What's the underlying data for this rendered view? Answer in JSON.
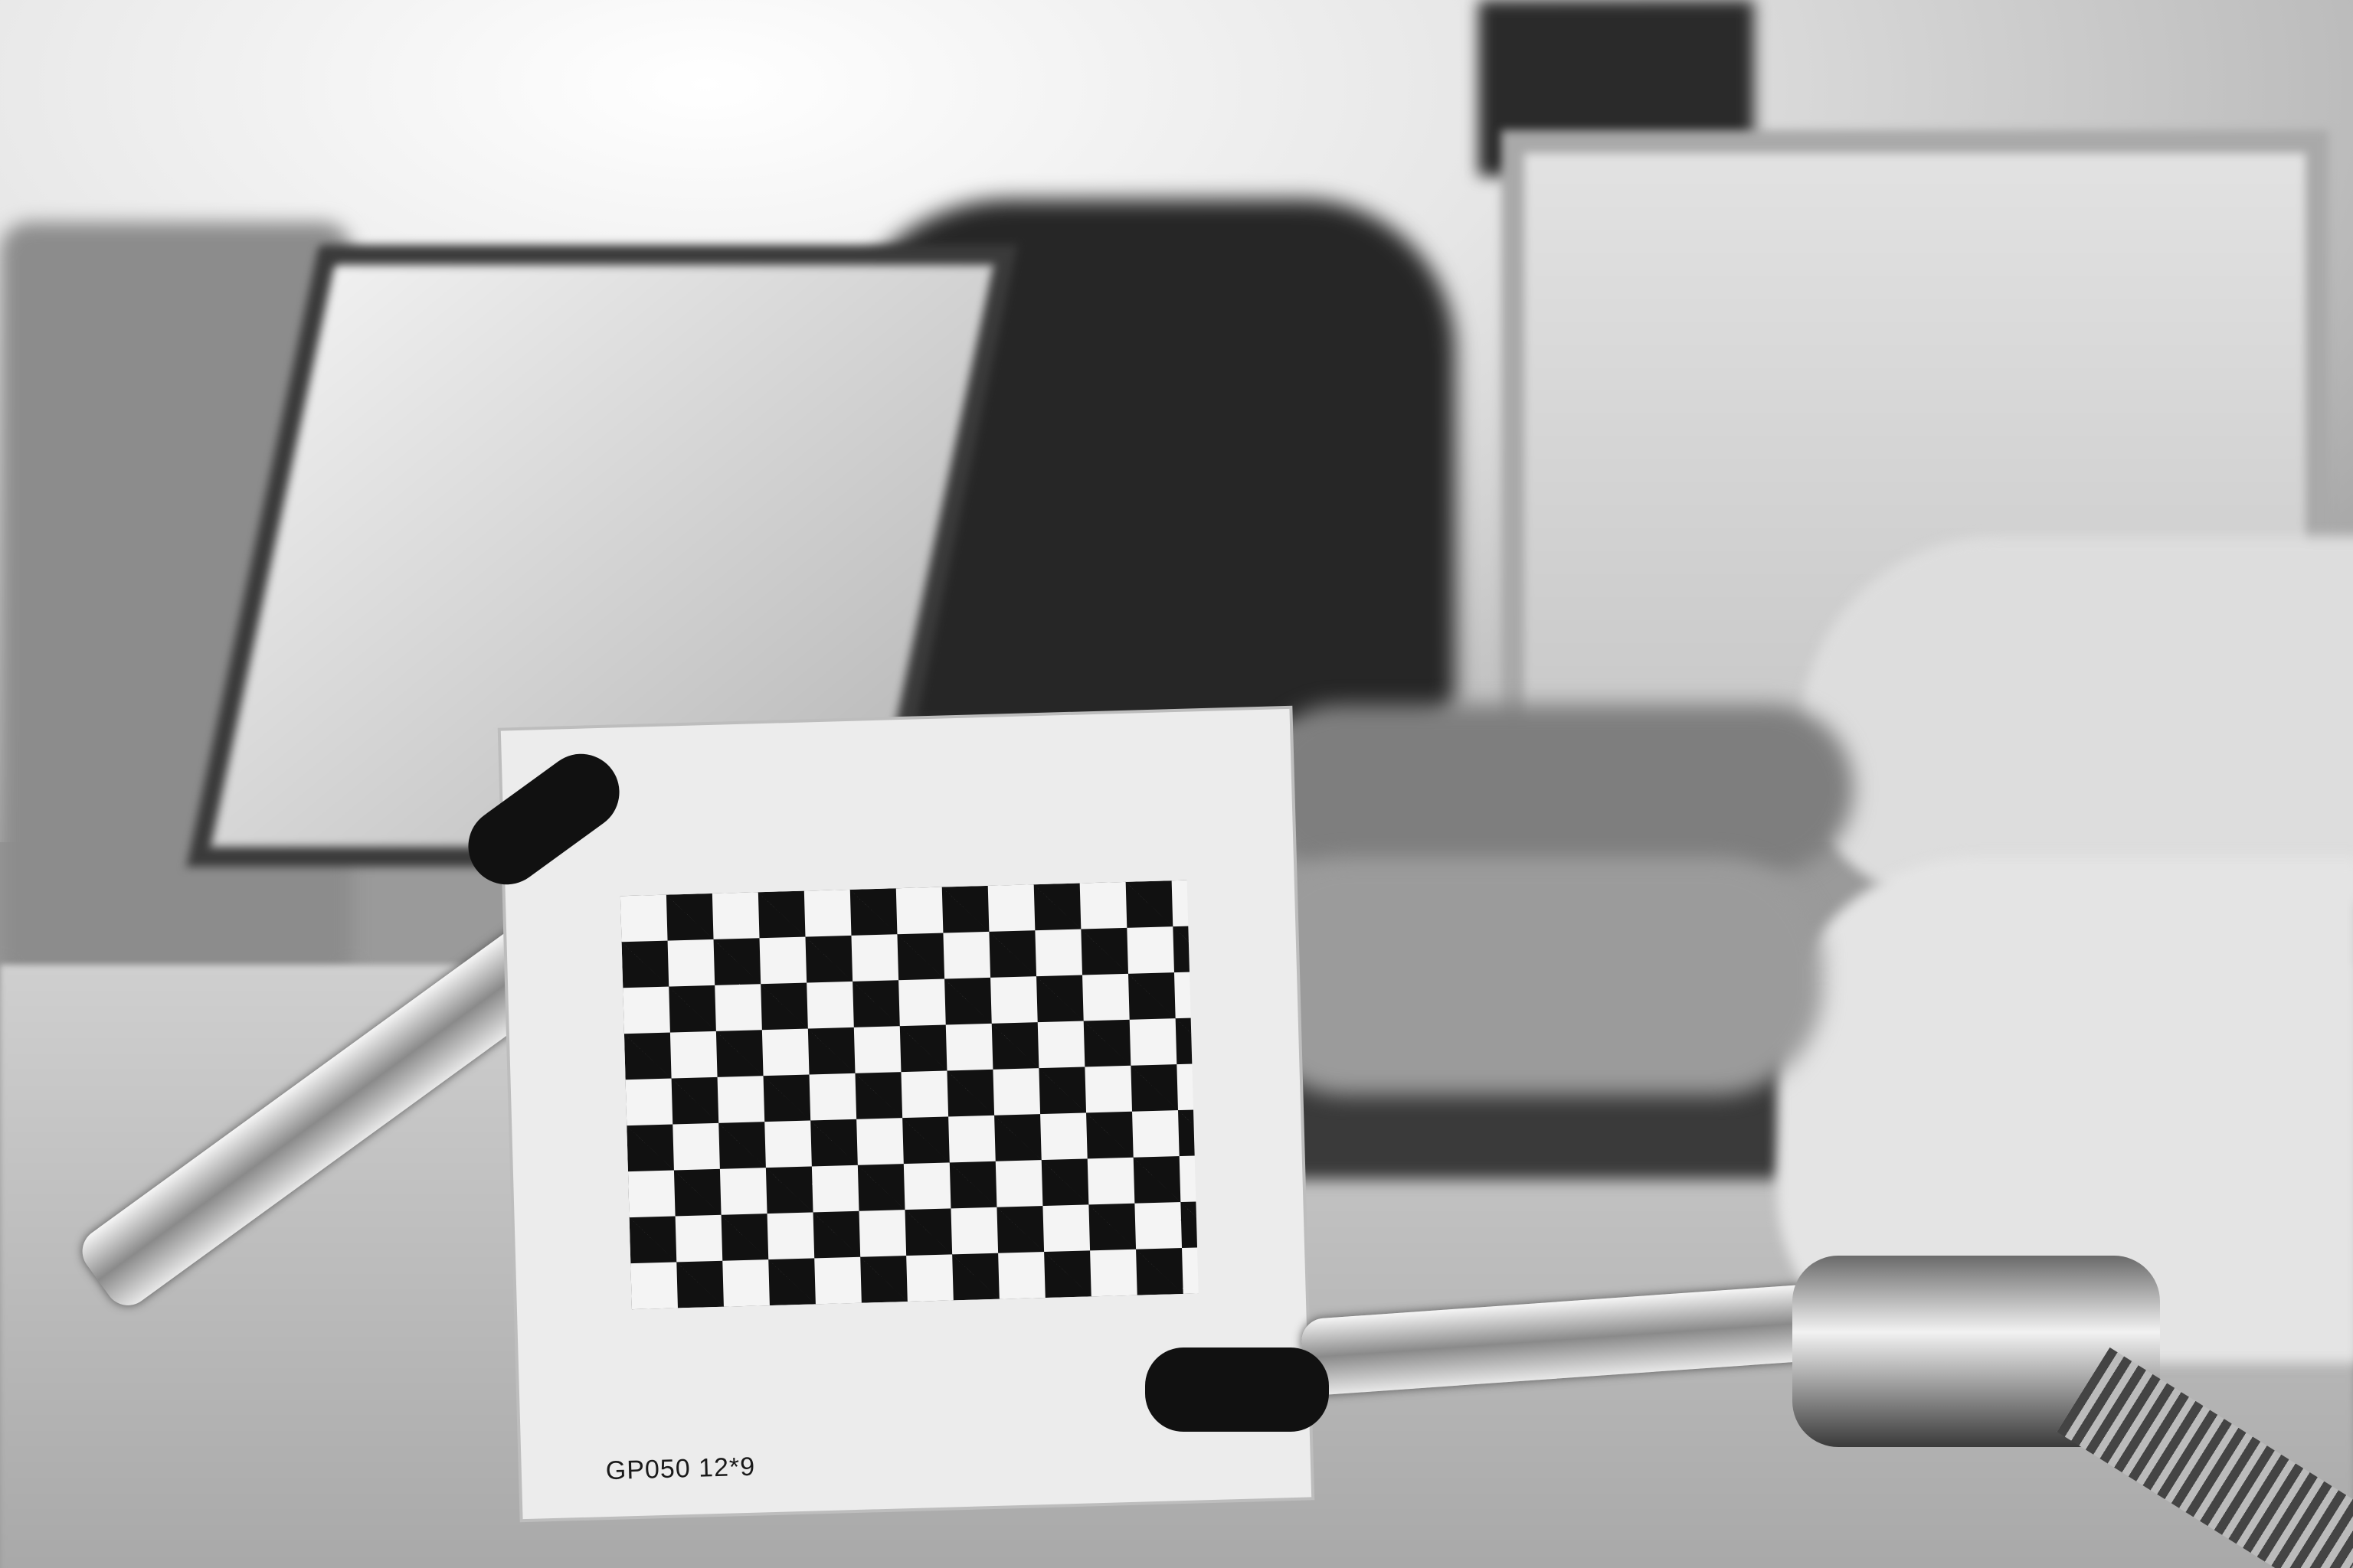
{
  "scene": {
    "description_colors": {
      "palette": "grayscale"
    }
  },
  "calibration_board": {
    "label": "GP050 12*9",
    "pattern": "checkerboard"
  }
}
